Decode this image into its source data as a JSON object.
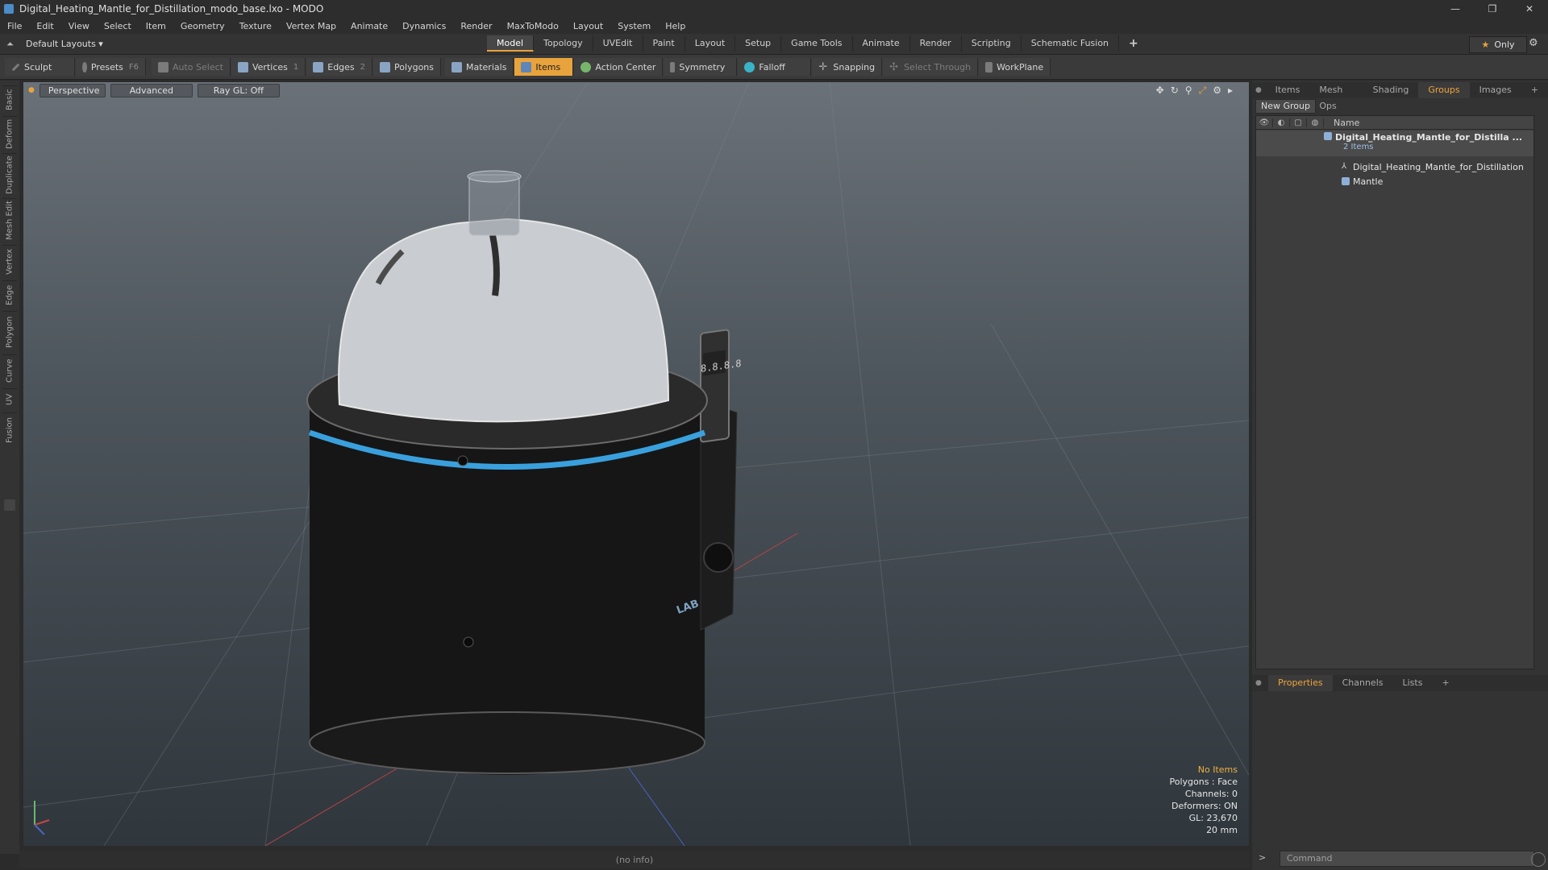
{
  "window": {
    "title": "Digital_Heating_Mantle_for_Distillation_modo_base.lxo - MODO",
    "buttons": [
      "—",
      "❐",
      "✕"
    ]
  },
  "menu": [
    "File",
    "Edit",
    "View",
    "Select",
    "Item",
    "Geometry",
    "Texture",
    "Vertex Map",
    "Animate",
    "Dynamics",
    "Render",
    "MaxToModo",
    "Layout",
    "System",
    "Help"
  ],
  "layoutbar": {
    "layout_label": "Default Layouts ▾",
    "tabs": [
      "Model",
      "Topology",
      "UVEdit",
      "Paint",
      "Layout",
      "Setup",
      "Game Tools",
      "Animate",
      "Render",
      "Scripting",
      "Schematic Fusion",
      "+"
    ],
    "active_tab": "Model",
    "only_label": "Only"
  },
  "toolbar": {
    "sculpt": "Sculpt",
    "presets": "Presets",
    "presets_key": "F6",
    "auto_select": "Auto Select",
    "vertices": "Vertices",
    "vertices_count": "1",
    "edges": "Edges",
    "edges_count": "2",
    "polygons": "Polygons",
    "materials": "Materials",
    "items": "Items",
    "action_center": "Action Center",
    "symmetry": "Symmetry",
    "falloff": "Falloff",
    "snapping": "Snapping",
    "select_through": "Select Through",
    "workplane": "WorkPlane"
  },
  "left_tabs": [
    "Basic",
    "Deform",
    "Duplicate",
    "Mesh Edit",
    "Vertex",
    "Edge",
    "Polygon",
    "Curve",
    "UV",
    "Fusion"
  ],
  "viewport": {
    "view_mode": "Perspective",
    "shading": "Advanced",
    "raygl": "Ray GL: Off",
    "info": {
      "selection": "No Items",
      "polygons": "Polygons : Face",
      "channels": "Channels: 0",
      "deformers": "Deformers: ON",
      "gl": "GL: 23,670",
      "scale": "20 mm"
    },
    "brand": "LAB",
    "display": "8.8.8.8"
  },
  "status": {
    "text": "(no info)"
  },
  "right_panel": {
    "tabs": [
      "Items",
      "Mesh Ops",
      "Shading",
      "Groups",
      "Images",
      "+"
    ],
    "active_tab": "Groups",
    "new_group": "New Group",
    "column_name": "Name",
    "group": {
      "name": "Digital_Heating_Mantle_for_Distilla ...",
      "count": "2 Items",
      "children": [
        "Digital_Heating_Mantle_for_Distillation",
        "Mantle"
      ]
    },
    "bottom_tabs": [
      "Properties",
      "Channels",
      "Lists",
      "+"
    ],
    "bottom_active": "Properties",
    "command_placeholder": "Command"
  },
  "colors": {
    "accent": "#e8a33d",
    "panel": "#333333",
    "viewport_top": "#6a7178"
  }
}
